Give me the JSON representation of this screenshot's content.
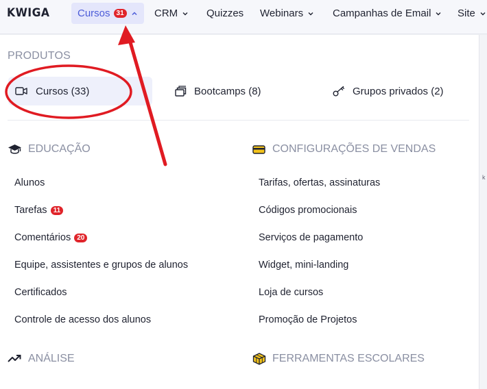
{
  "brand": "KWIGA",
  "nav": {
    "cursos": {
      "label": "Cursos",
      "badge": "31"
    },
    "crm": "CRM",
    "quizzes": "Quizzes",
    "webinars": "Webinars",
    "email": "Campanhas de Email",
    "site": "Site"
  },
  "products": {
    "title": "PRODUTOS",
    "items": [
      {
        "label": "Cursos (33)",
        "icon": "video-icon"
      },
      {
        "label": "Bootcamps (8)",
        "icon": "bootcamp-icon"
      },
      {
        "label": "Grupos privados (2)",
        "icon": "key-icon"
      }
    ]
  },
  "educacao": {
    "title": "EDUCAÇÃO",
    "items": {
      "alunos": "Alunos",
      "tarefas": {
        "label": "Tarefas",
        "badge": "11"
      },
      "comentarios": {
        "label": "Comentários",
        "badge": "20"
      },
      "equipe": "Equipe, assistentes e grupos de alunos",
      "certificados": "Certificados",
      "controle": "Controle de acesso dos alunos"
    }
  },
  "vendas": {
    "title": "CONFIGURAÇÕES DE VENDAS",
    "items": [
      "Tarifas, ofertas, assinaturas",
      "Códigos promocionais",
      "Serviços de pagamento",
      "Widget, mini-landing",
      "Loja de cursos",
      "Promoção de Projetos"
    ]
  },
  "analise": {
    "title": "ANÁLISE"
  },
  "ferramentas": {
    "title": "FERRAMENTAS ESCOLARES"
  },
  "colors": {
    "accent": "#4b5bd8",
    "badge": "#e0242a",
    "annotation": "#e01b22",
    "muted": "#8a8fa2"
  }
}
